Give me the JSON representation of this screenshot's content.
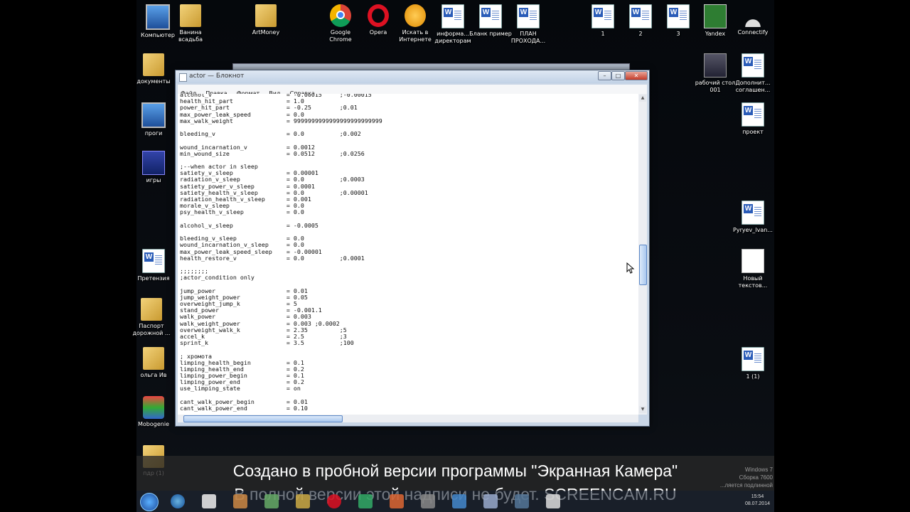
{
  "desktop": {
    "icons": [
      {
        "label": "Компьютер",
        "type": "monitor"
      },
      {
        "label": "Ванина всадьба",
        "type": "folder"
      },
      {
        "label": "ArtMoney",
        "type": "folder"
      },
      {
        "label": "Google Chrome",
        "type": "chrome"
      },
      {
        "label": "Opera",
        "type": "opera"
      },
      {
        "label": "Искать в Интернете",
        "type": "search"
      },
      {
        "label": "информа... директорам",
        "type": "doc"
      },
      {
        "label": "Бланк пример",
        "type": "doc"
      },
      {
        "label": "ПЛАН ПРОХОДА...",
        "type": "doc"
      },
      {
        "label": "1",
        "type": "doc"
      },
      {
        "label": "2",
        "type": "doc"
      },
      {
        "label": "3",
        "type": "doc"
      },
      {
        "label": "Yandex",
        "type": "excel"
      },
      {
        "label": "Connectify",
        "type": "net"
      },
      {
        "label": "документы",
        "type": "folder"
      },
      {
        "label": "проги",
        "type": "monitor"
      },
      {
        "label": "игры",
        "type": "game"
      },
      {
        "label": "Претензия",
        "type": "doc"
      },
      {
        "label": "Паспорт дорожной ...",
        "type": "folder"
      },
      {
        "label": "ольга Ив",
        "type": "folder"
      },
      {
        "label": "Mobogenie",
        "type": "ie"
      },
      {
        "label": "пдр (1)",
        "type": "folder"
      },
      {
        "label": "рабочий стол 001",
        "type": "person"
      },
      {
        "label": "Дополнит... соглашен...",
        "type": "doc"
      },
      {
        "label": "проект",
        "type": "doc"
      },
      {
        "label": "Pyryev_Ivan...",
        "type": "doc"
      },
      {
        "label": "Новый текстов...",
        "type": "blank"
      },
      {
        "label": "1 (1)",
        "type": "doc"
      }
    ]
  },
  "notepad": {
    "title": "actor — Блокнот",
    "menu": [
      "Файл",
      "Правка",
      "Формат",
      "Вид",
      "Справка"
    ],
    "content": "alcohol_v                     = -0.00015     ;-0.00015\nhealth_hit_part               = 1.0\npower_hit_part                = -0.25        ;0.01\nmax_power_leak_speed          = 0.0\nmax_walk_weight               = 9999999999999999999999999\n\nbleeding_v                    = 0.0          ;0.002\n\nwound_incarnation_v           = 0.0012\nmin_wound_size                = 0.0512       ;0.0256\n\n;--when actor in sleep\nsatiety_v_sleep               = 0.00001\nradiation_v_sleep             = 0.0          ;0.0003\nsatiety_power_v_sleep         = 0.0001\nsatiety_health_v_sleep        = 0.0          ;0.00001\nradiation_health_v_sleep      = 0.001\nmorale_v_sleep                = 0.0\npsy_health_v_sleep            = 0.0\n\nalcohol_v_sleep               = -0.0005\n\nbleeding_v_sleep              = 0.0\nwound_incarnation_v_sleep     = 0.0\nmax_power_leak_speed_sleep    = -0.00001\nhealth_restore_v              = 0.0          ;0.0001\n\n;;;;;;;;\n;actor_condition only\n\njump_power                    = 0.01\njump_weight_power             = 0.05\noverweight_jump_k             = 5\nstand_power                   = -0.001.1\nwalk_power                    = 0.003\nwalk_weight_power             = 0.003 ;0.0002\noverweight_walk_k             = 2.35         ;5\naccel_k                       = 2.5          ;3\nsprint_k                      = 3.5          ;100\n\n; хромота\nlimping_health_begin          = 0.1\nlimping_health_end            = 0.2\nlimping_power_begin           = 0.1\nlimping_power_end             = 0.2\nuse_limping_state             = on\n\ncant_walk_power_begin         = 0.01\ncant_walk_power_end           = 0.10"
  },
  "watermark": {
    "line1": "Создано в пробной версии программы \"Экранная Камера\"",
    "line2": "В полной версии этой надписи не будет. SCREENCAM.RU"
  },
  "windows_info": [
    "Windows 7",
    "Сборка 7600",
    "...ляется подлинной"
  ],
  "clock": {
    "time": "15:54",
    "date": "08.07.2014"
  }
}
